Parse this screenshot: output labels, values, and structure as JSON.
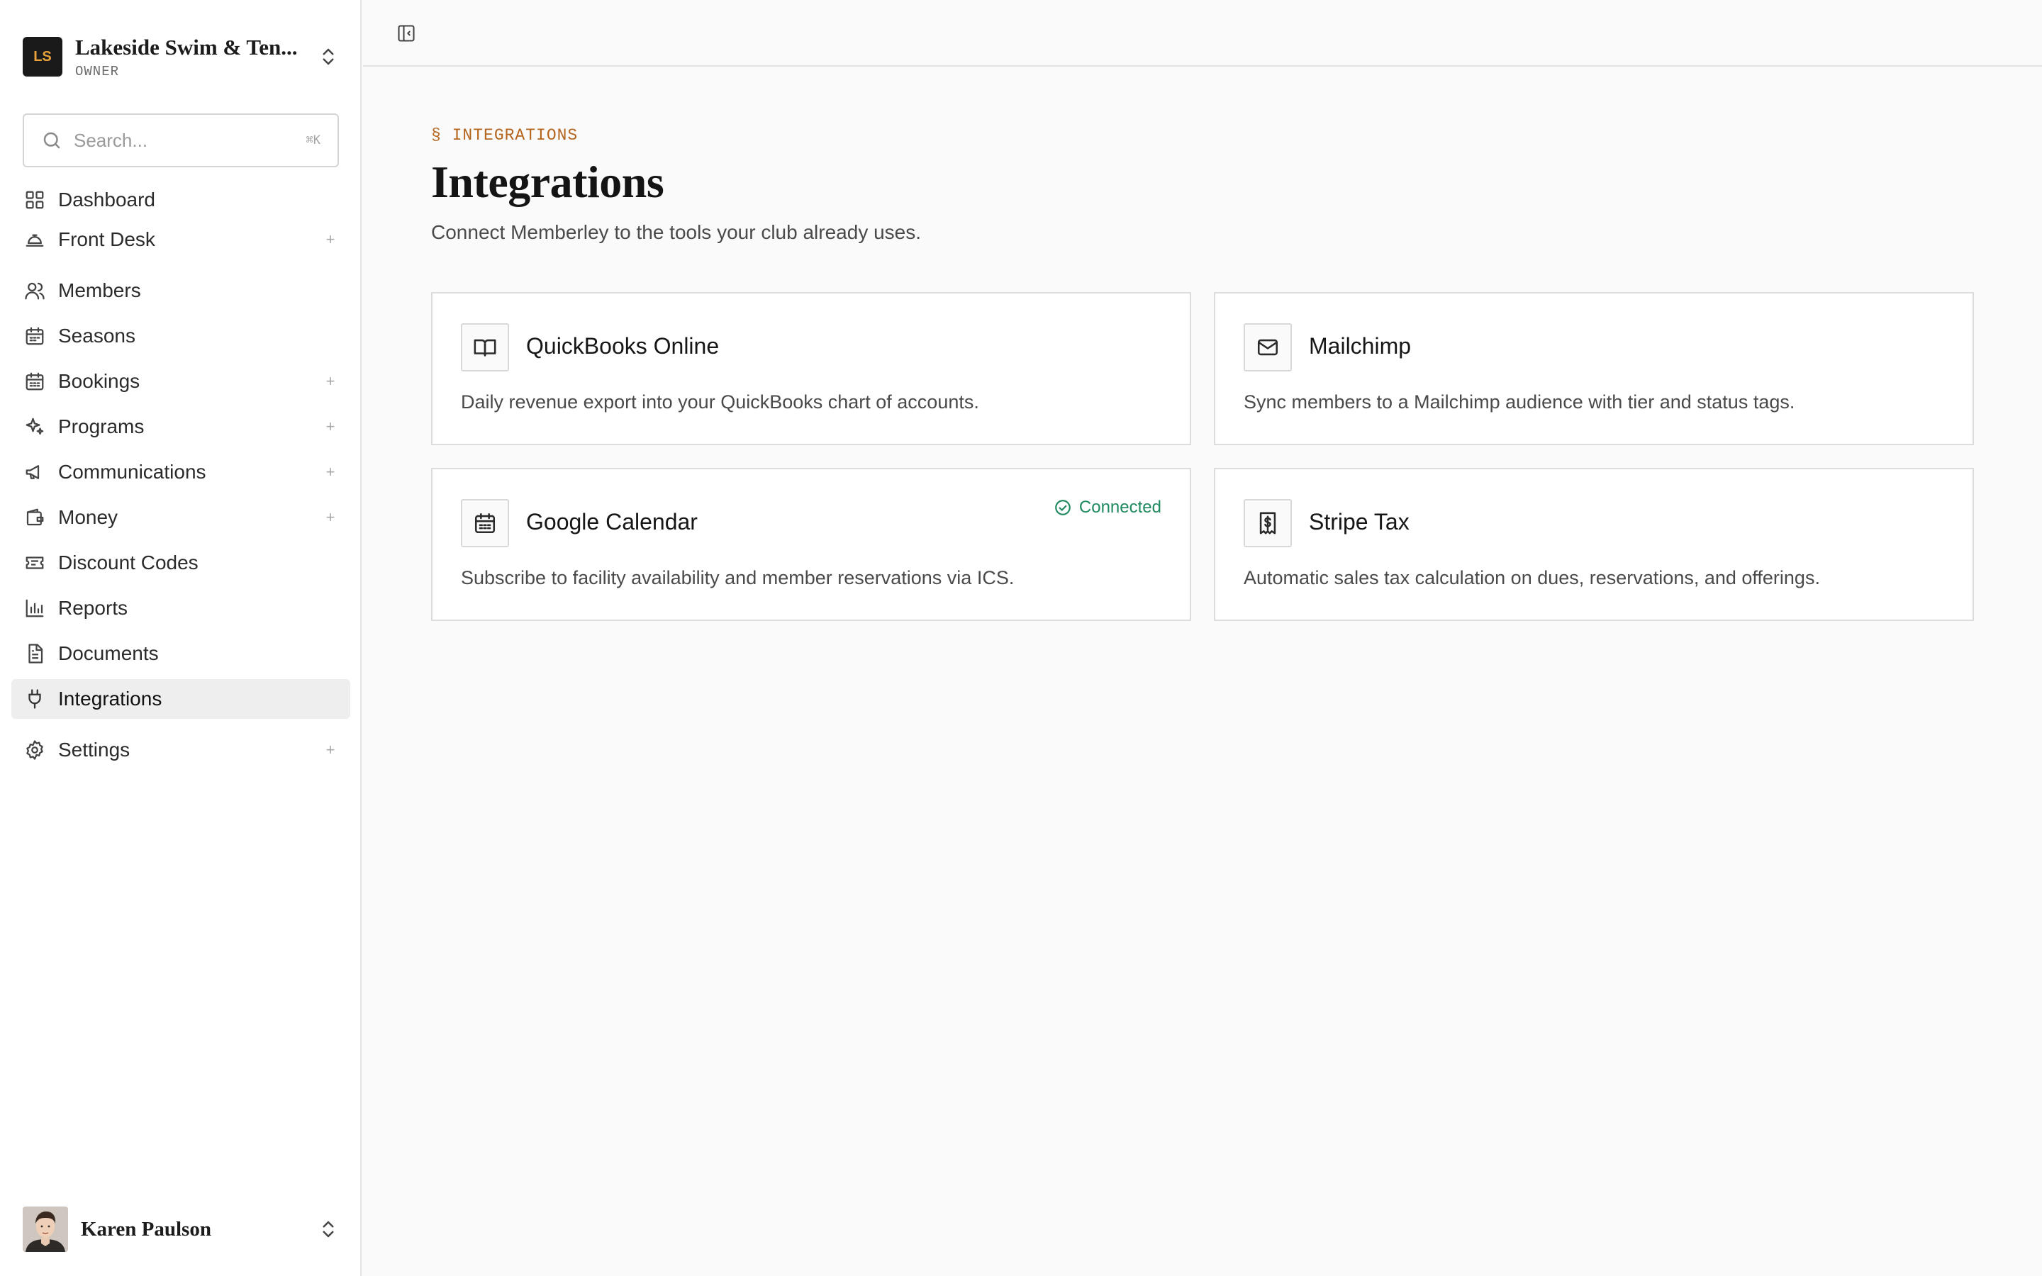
{
  "org": {
    "initials": "LS",
    "name": "Lakeside Swim & Ten...",
    "role": "OWNER"
  },
  "search": {
    "placeholder": "Search...",
    "shortcut": "⌘K"
  },
  "nav": [
    {
      "label": "Dashboard",
      "icon": "dashboard-grid-icon",
      "expandable": false
    },
    {
      "label": "Front Desk",
      "icon": "concierge-bell-icon",
      "expandable": true
    },
    {
      "label": "Members",
      "icon": "users-icon",
      "expandable": false
    },
    {
      "label": "Seasons",
      "icon": "calendar-icon",
      "expandable": false
    },
    {
      "label": "Bookings",
      "icon": "calendar-check-icon",
      "expandable": true
    },
    {
      "label": "Programs",
      "icon": "sparkles-icon",
      "expandable": true
    },
    {
      "label": "Communications",
      "icon": "megaphone-icon",
      "expandable": true
    },
    {
      "label": "Money",
      "icon": "wallet-icon",
      "expandable": true
    },
    {
      "label": "Discount Codes",
      "icon": "ticket-icon",
      "expandable": false
    },
    {
      "label": "Reports",
      "icon": "bar-chart-icon",
      "expandable": false
    },
    {
      "label": "Documents",
      "icon": "file-text-icon",
      "expandable": false
    },
    {
      "label": "Integrations",
      "icon": "plug-icon",
      "expandable": false,
      "active": true
    },
    {
      "label": "Settings",
      "icon": "gear-icon",
      "expandable": true
    }
  ],
  "expand_symbol": "+",
  "user": {
    "name": "Karen Paulson"
  },
  "page": {
    "eyebrow": "§ INTEGRATIONS",
    "title": "Integrations",
    "subtitle": "Connect Memberley to the tools your club already uses."
  },
  "integrations": [
    {
      "name": "QuickBooks Online",
      "icon": "book-open-icon",
      "description": "Daily revenue export into your QuickBooks chart of accounts.",
      "status": ""
    },
    {
      "name": "Mailchimp",
      "icon": "mail-icon",
      "description": "Sync members to a Mailchimp audience with tier and status tags.",
      "status": ""
    },
    {
      "name": "Google Calendar",
      "icon": "calendar-icon",
      "description": "Subscribe to facility availability and member reservations via ICS.",
      "status": "Connected"
    },
    {
      "name": "Stripe Tax",
      "icon": "receipt-dollar-icon",
      "description": "Automatic sales tax calculation on dues, reservations, and offerings.",
      "status": ""
    }
  ],
  "colors": {
    "accent_eyebrow": "#b5651d",
    "connected": "#1f8a5f",
    "active_nav_bg": "#eeeeee"
  }
}
